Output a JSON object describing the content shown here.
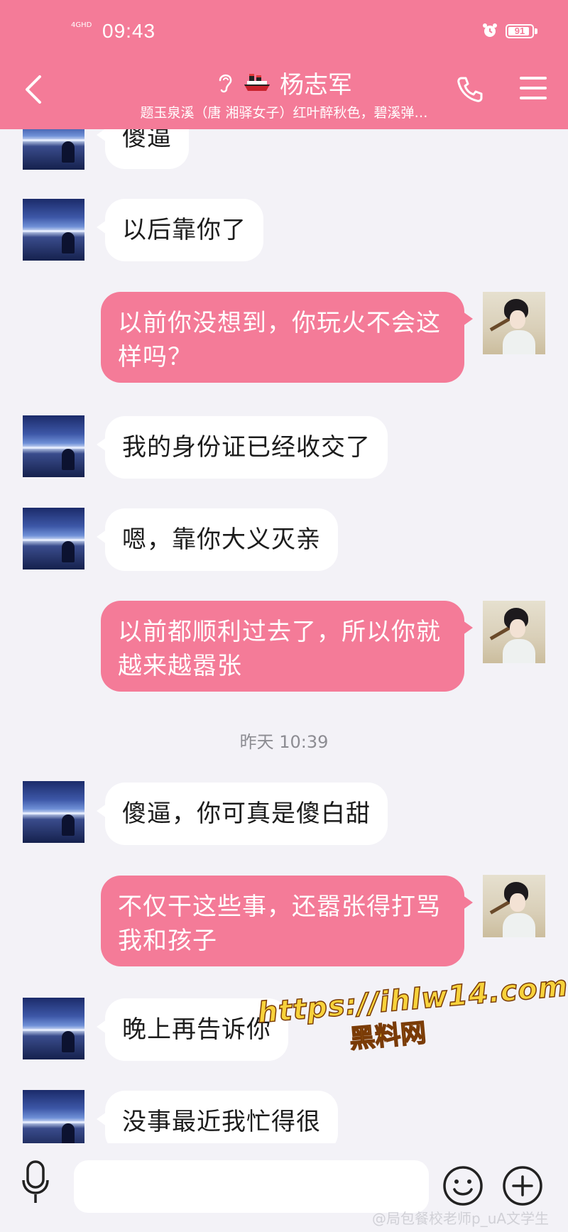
{
  "status_bar": {
    "network": "4GHD",
    "time": "09:43",
    "battery": "91",
    "battery_level": 0.91
  },
  "header": {
    "title": "杨志军",
    "subtitle": "题玉泉溪（唐 湘驿女子）红叶醉秋色，碧溪弹…"
  },
  "messages": [
    {
      "side": "left",
      "text": "傻逼"
    },
    {
      "side": "left",
      "text": "以后靠你了"
    },
    {
      "side": "right",
      "text": "以前你没想到，你玩火不会这样吗？"
    },
    {
      "side": "left",
      "text": "我的身份证已经收交了"
    },
    {
      "side": "left",
      "text": "嗯，靠你大义灭亲"
    },
    {
      "side": "right",
      "text": "以前都顺利过去了，所以你就越来越嚣张"
    },
    {
      "side": "left",
      "text": "傻逼，你可真是傻白甜"
    },
    {
      "side": "right",
      "text": "不仅干这些事，还嚣张得打骂我和孩子"
    },
    {
      "side": "left",
      "text": "晚上再告诉你"
    },
    {
      "side": "left",
      "text": "没事最近我忙得很"
    }
  ],
  "timestamp": "昨天 10:39",
  "watermark": {
    "line1": "https://ihlw14.com",
    "line2": "黑料网"
  },
  "credit": "@局包餐校老师p_uA文学生",
  "colors": {
    "accent": "#f47b98",
    "background": "#f3f2f7",
    "bubble_left": "#ffffff"
  },
  "icons": [
    "back-arrow-icon",
    "ear-icon",
    "ship-icon",
    "phone-icon",
    "menu-icon",
    "mic-icon",
    "smile-icon",
    "plus-icon",
    "alarm-icon"
  ]
}
